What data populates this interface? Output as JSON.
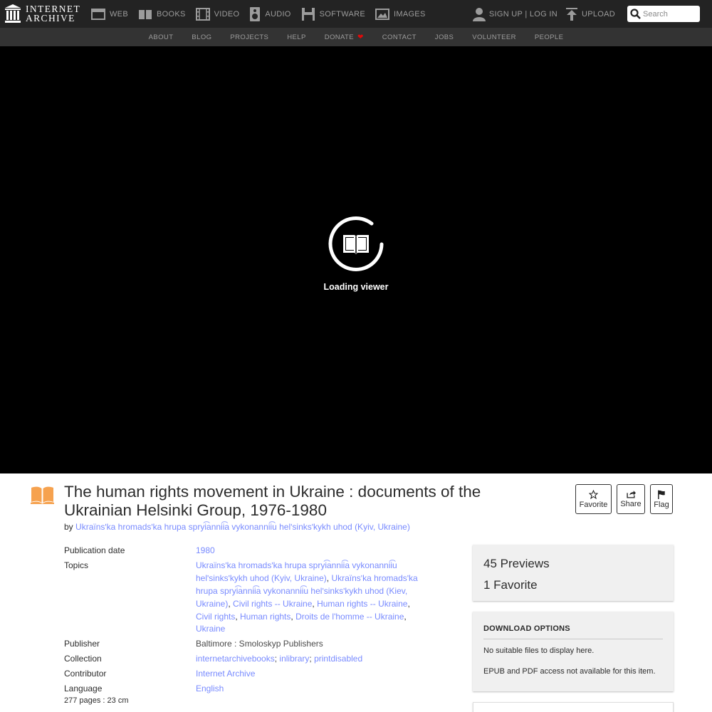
{
  "header": {
    "logo": {
      "line1": "INTERNET",
      "line2": "ARCHIVE"
    },
    "media_types": [
      {
        "label": "WEB",
        "icon": "web-icon"
      },
      {
        "label": "BOOKS",
        "icon": "books-icon"
      },
      {
        "label": "VIDEO",
        "icon": "video-icon"
      },
      {
        "label": "AUDIO",
        "icon": "audio-icon"
      },
      {
        "label": "SOFTWARE",
        "icon": "software-icon"
      },
      {
        "label": "IMAGES",
        "icon": "images-icon"
      }
    ],
    "user_label": "SIGN UP | LOG IN",
    "upload_label": "UPLOAD",
    "search_placeholder": "Search"
  },
  "subnav": {
    "items": [
      "ABOUT",
      "BLOG",
      "PROJECTS",
      "HELP",
      "DONATE",
      "CONTACT",
      "JOBS",
      "VOLUNTEER",
      "PEOPLE"
    ]
  },
  "viewer": {
    "loading_text": "Loading viewer"
  },
  "item": {
    "title": "The human rights movement in Ukraine : documents of the Ukrainian Helsinki Group, 1976-1980",
    "by_label": "by",
    "author": "Ukraïnsʹka hromadsʹka hrupa spryi͡annii͡a vykonannii͡u helʹsinksʹkykh uhod (Kyiv, Ukraine)",
    "actions": {
      "favorite": "Favorite",
      "share": "Share",
      "flag": "Flag"
    },
    "metadata": {
      "publication_date_label": "Publication date",
      "publication_date": "1980",
      "topics_label": "Topics",
      "topics": [
        "Ukraïnsʹka hromadsʹka hrupa spryi͡annii͡a vykonannii͡u helʹsinksʹkykh uhod (Kyiv, Ukraine)",
        "Ukraïnsʹka hromadsʹka hrupa spryi͡annii͡a vykonannii͡u helʹsinksʹkykh uhod (Kiev, Ukraine)",
        "Civil rights -- Ukraine",
        "Human rights -- Ukraine",
        "Civil rights",
        "Human rights",
        "Droits de l'homme -- Ukraine",
        "Ukraine"
      ],
      "publisher_label": "Publisher",
      "publisher": "Baltimore : Smoloskyp Publishers",
      "collection_label": "Collection",
      "collections": [
        "internetarchivebooks",
        "inlibrary",
        "printdisabled"
      ],
      "contributor_label": "Contributor",
      "contributor": "Internet Archive",
      "language_label": "Language",
      "language": "English",
      "notes": "277 pages : 23 cm"
    }
  },
  "stats": {
    "previews": "45 Previews",
    "favorites": "1 Favorite"
  },
  "downloads": {
    "heading": "DOWNLOAD OPTIONS",
    "no_files": "No suitable files to display here.",
    "access_note": "EPUB and PDF access not available for this item."
  }
}
